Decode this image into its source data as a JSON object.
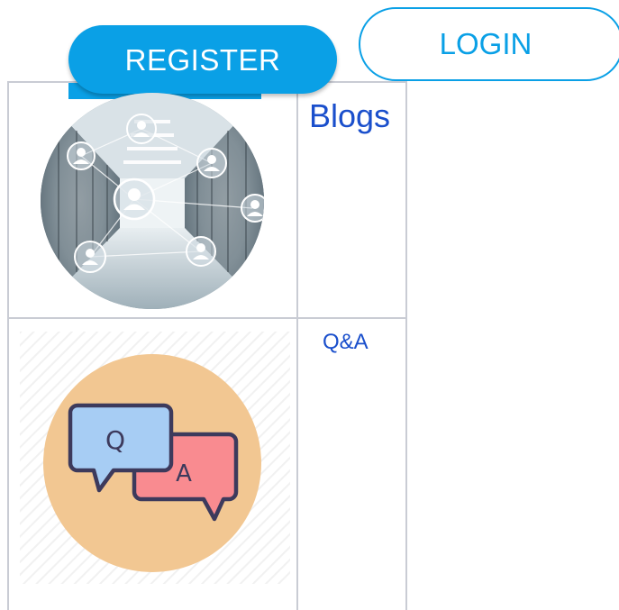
{
  "header": {
    "register_label": "REGISTER",
    "login_label": "LOGIN"
  },
  "sections": [
    {
      "id": "blogs",
      "link_label": "Blogs",
      "icon": "datacenter-network-icon"
    },
    {
      "id": "qa",
      "link_label": "Q&A",
      "icon": "qa-chat-bubbles-icon"
    }
  ],
  "colors": {
    "accent": "#0aa0e6",
    "link": "#1a4fcc",
    "grid": "#c9ccd4",
    "qa_circle": "#f2c792",
    "q_bubble": "#a7cdf4",
    "a_bubble": "#f98b90",
    "outline": "#3d3a5c"
  }
}
